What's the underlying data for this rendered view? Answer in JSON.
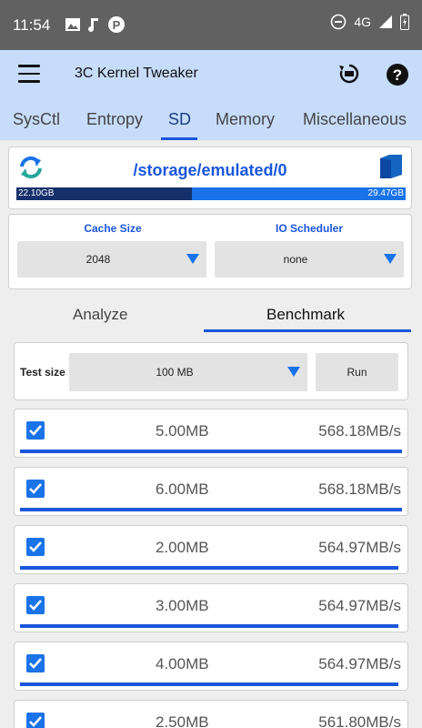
{
  "status_bar": {
    "time": "11:54",
    "network": "4G"
  },
  "app_bar": {
    "title": "3C Kernel Tweaker"
  },
  "tabs": [
    "SysCtl",
    "Entropy",
    "SD",
    "Memory",
    "Miscellaneous"
  ],
  "active_tab": "SD",
  "storage": {
    "path": "/storage/emulated/0",
    "used": "22.10GB",
    "total": "29.47GB",
    "used_fraction": 0.45
  },
  "settings": {
    "cache_label": "Cache Size",
    "cache_value": "2048",
    "io_label": "IO Scheduler",
    "io_value": "none"
  },
  "subtabs": [
    "Analyze",
    "Benchmark"
  ],
  "active_subtab": "Benchmark",
  "test": {
    "label": "Test size",
    "value": "100 MB",
    "run": "Run"
  },
  "results": [
    {
      "size": "5.00MB",
      "speed": "568.18MB/s",
      "fill": 1.0
    },
    {
      "size": "6.00MB",
      "speed": "568.18MB/s",
      "fill": 1.0
    },
    {
      "size": "2.00MB",
      "speed": "564.97MB/s",
      "fill": 0.99
    },
    {
      "size": "3.00MB",
      "speed": "564.97MB/s",
      "fill": 0.99
    },
    {
      "size": "4.00MB",
      "speed": "564.97MB/s",
      "fill": 0.99
    },
    {
      "size": "2.50MB",
      "speed": "561.80MB/s",
      "fill": 0.98
    }
  ],
  "colors": {
    "accent": "#1a56db",
    "appbar": "#c6dcfa",
    "statusbar": "#616161"
  }
}
